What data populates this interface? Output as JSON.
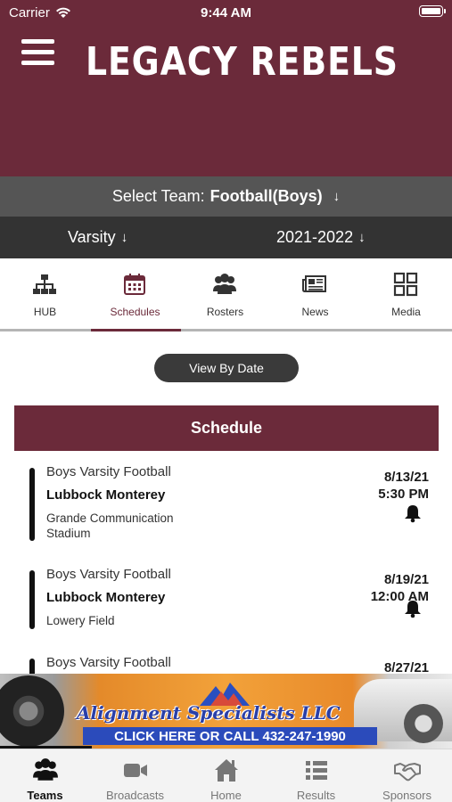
{
  "status_bar": {
    "carrier": "Carrier",
    "time": "9:44 AM"
  },
  "header": {
    "title": "LEGACY REBELS"
  },
  "team_select": {
    "label": "Select Team:",
    "value": "Football(Boys)"
  },
  "sub_select": {
    "level": "Varsity",
    "season": "2021-2022"
  },
  "tabs": [
    {
      "label": "HUB",
      "icon": "hierarchy-icon"
    },
    {
      "label": "Schedules",
      "icon": "calendar-icon",
      "active": true
    },
    {
      "label": "Rosters",
      "icon": "people-icon"
    },
    {
      "label": "News",
      "icon": "newspaper-icon"
    },
    {
      "label": "Media",
      "icon": "grid-icon"
    }
  ],
  "view_button": "View By Date",
  "schedule": {
    "title": "Schedule",
    "games": [
      {
        "sport": "Boys Varsity Football",
        "opponent": "Lubbock Monterey",
        "venue": "Grande Communication Stadium",
        "date": "8/13/21",
        "time": "5:30 PM"
      },
      {
        "sport": "Boys Varsity Football",
        "opponent": "Lubbock Monterey",
        "venue": "Lowery Field",
        "date": "8/19/21",
        "time": "12:00 AM"
      },
      {
        "sport": "Boys Varsity Football",
        "opponent": "",
        "venue": "",
        "date": "8/27/21",
        "time": ""
      }
    ]
  },
  "ad": {
    "title": "Alignment Specialists LLC",
    "cta": "CLICK HERE OR CALL 432-247-1990"
  },
  "bottom_nav": [
    {
      "label": "Teams",
      "icon": "people-icon",
      "active": true
    },
    {
      "label": "Broadcasts",
      "icon": "video-camera-icon"
    },
    {
      "label": "Home",
      "icon": "home-icon"
    },
    {
      "label": "Results",
      "icon": "list-icon"
    },
    {
      "label": "Sponsors",
      "icon": "handshake-icon"
    }
  ],
  "colors": {
    "brand": "#6b2a3a",
    "team_bar": "#555555",
    "sub_bar": "#333333"
  }
}
